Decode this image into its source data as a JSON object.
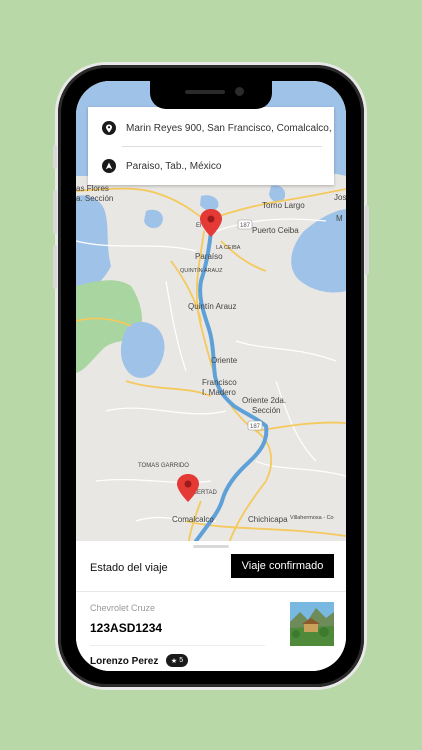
{
  "route": {
    "origin": "Marin Reyes 900, San Francisco, Comalcalco,",
    "destination": "Paraiso, Tab., México"
  },
  "map_labels": {
    "las_flores": "as Flores",
    "la_seccion": "a. Sección",
    "torno_largo": "Torno Largo",
    "puerto_ceiba": "Puerto Ceiba",
    "jose": "Jos",
    "m": "M",
    "el_bajio": "El B",
    "paraiso": "Paraíso",
    "la_ceiba": "LA CEIBA",
    "quintin_arauz_district": "QUINTÍN ARAUZ",
    "quintin_arauz": "Quintín Arauz",
    "oriente": "Oriente",
    "francisco": "Francisco",
    "i_madero": "I. Madero",
    "oriente_2da": "Oriente 2da.",
    "seccion": "Sección",
    "tomas_garrido": "TOMAS GARRIDO",
    "libertad": "LIBERTAD",
    "comalcalco": "Comalcalco",
    "chichicapa": "Chichicapa",
    "villahermosa": "Villahermosa - Co",
    "road_187": "187",
    "road_187b": "187"
  },
  "trip": {
    "status_label": "Estado del viaje",
    "status_value": "Viaje confirmado"
  },
  "vehicle": {
    "model": "Chevrolet Cruze",
    "plate": "123ASD1234"
  },
  "driver": {
    "name": "Lorenzo Perez",
    "rating": "5"
  },
  "colors": {
    "background": "#b8d8a7",
    "route": "#5ea1d8",
    "water": "#9fc3e8",
    "park": "#a8d5a0",
    "road": "#f4c95d",
    "pin": "#e53935"
  },
  "icons": [
    "location-pin-icon",
    "navigation-arrow-icon",
    "star-icon",
    "map-marker-icon"
  ]
}
